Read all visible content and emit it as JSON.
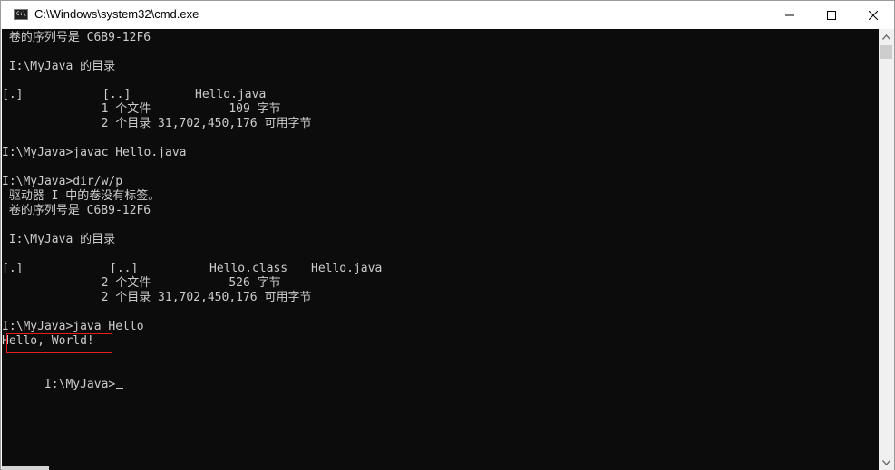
{
  "window": {
    "title": "C:\\Windows\\system32\\cmd.exe",
    "icon_label": "C:\\"
  },
  "colors": {
    "console_bg": "#0c0c0c",
    "console_text": "#cccccc",
    "highlight": "#e02020"
  },
  "console": {
    "lines": [
      " 卷的序列号是 C6B9-12F6",
      "",
      " I:\\MyJava 的目录",
      "",
      "[.]",
      "              1 个文件           109 字节",
      "              2 个目录 31,702,450,176 可用字节",
      "",
      "I:\\MyJava>javac Hello.java",
      "",
      "I:\\MyJava>dir/w/p",
      " 驱动器 I 中的卷没有标签。",
      " 卷的序列号是 C6B9-12F6",
      "",
      " I:\\MyJava 的目录",
      "",
      "[.]",
      "              2 个文件           526 字节",
      "              2 个目录 31,702,450,176 可用字节",
      "",
      "I:\\MyJava>java Hello",
      "Hello, World!",
      "",
      "I:\\MyJava>"
    ],
    "listing1_cols": [
      "[..]",
      "Hello.java"
    ],
    "listing2_cols": [
      "[..]",
      "Hello.class",
      "Hello.java"
    ]
  },
  "icons": {
    "minimize": "minimize-icon",
    "maximize": "maximize-icon",
    "close": "close-icon",
    "scroll_up": "scroll-up-icon",
    "scroll_down": "scroll-down-icon"
  }
}
